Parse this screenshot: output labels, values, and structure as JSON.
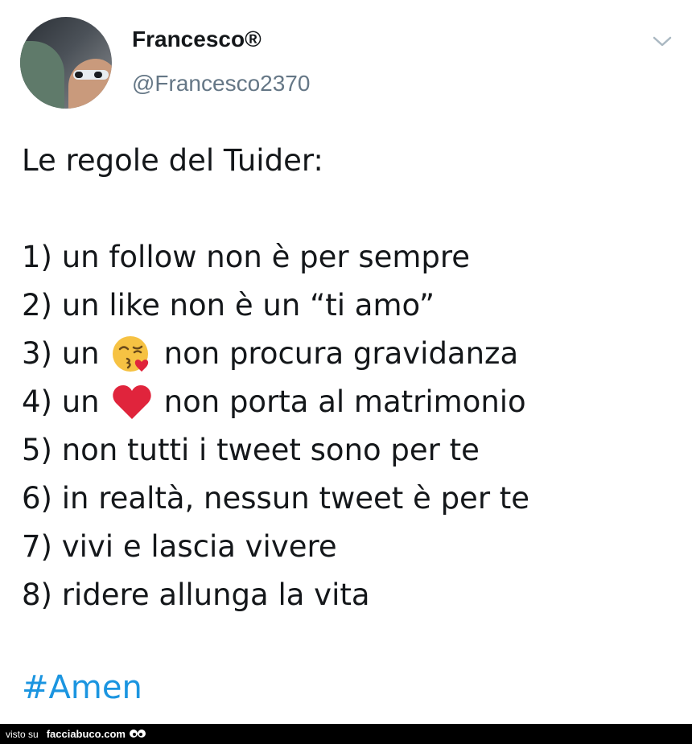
{
  "tweet": {
    "author_name": "Francesco®",
    "author_handle": "@Francesco2370",
    "lines": {
      "title": "Le regole del Tuider:",
      "l1": "1) un follow non è per sempre",
      "l2": "2) un like non è un “ti amo”",
      "l3_prefix": "3) un",
      "l3_suffix": "non procura gravidanza",
      "l4_prefix": "4) un",
      "l4_suffix": "non porta al matrimonio",
      "l5": "5) non tutti i tweet sono per te",
      "l6": "6) in realtà, nessun tweet è per te",
      "l7": "7) vivi e lascia vivere",
      "l8": "8) ridere allunga la vita"
    },
    "hashtag": "#Amen",
    "emoji_kiss": "kissing-face-icon",
    "emoji_heart": "red-heart-icon",
    "colors": {
      "text": "#14171a",
      "handle": "#657786",
      "hashtag": "#1b95e0",
      "heart": "#e0243c",
      "kiss_face": "#f6c243"
    }
  },
  "footer": {
    "label": "visto su",
    "brand": "facciabuco.com"
  }
}
